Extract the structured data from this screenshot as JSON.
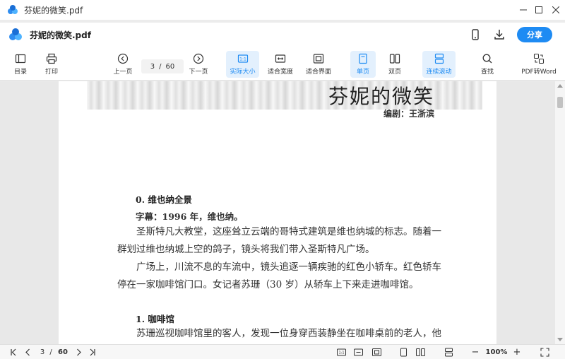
{
  "window": {
    "title": "芬妮的微笑.pdf",
    "controls": [
      "minimize-icon",
      "maximize-icon",
      "close-icon"
    ]
  },
  "header": {
    "doc_title": "芬妮的微笑.pdf",
    "share_label": "分享",
    "icons": [
      "mobile-icon",
      "download-icon"
    ]
  },
  "toolbar": {
    "toc": "目录",
    "print": "打印",
    "prev": "上一页",
    "current_page": "3",
    "separator": "/",
    "total_pages": "60",
    "next": "下一页",
    "actual_size": "实际大小",
    "fit_width": "适合宽度",
    "fit_page": "适合界面",
    "single_page": "单页",
    "double_page": "双页",
    "continuous": "连续滚动",
    "search": "查找",
    "pdf_to_word": "PDF转Word"
  },
  "document": {
    "title": "芬妮的微笑",
    "editor": "编剧：王浙滨",
    "sections": [
      {
        "heading": "0.  维也纳全景",
        "caption": "字幕：1996 年，维也纳。",
        "paragraphs": [
          "圣斯特凡大教堂，这座耸立云端的哥特式建筑是维也纳城的标志。随着一",
          "群划过维也纳城上空的鸽子，镜头将我们带入圣斯特凡广场。",
          "广场上，川流不息的车流中，镜头追逐一辆疾驰的红色小轿车。红色轿车",
          "停在一家咖啡馆门口。女记者苏珊（30 岁）从轿车上下来走进咖啡馆。"
        ]
      },
      {
        "heading": "1.  咖啡馆",
        "paragraphs": [
          "苏珊巡视咖啡馆里的客人，发现一位身穿西装静坐在咖啡桌前的老人，他"
        ]
      }
    ]
  },
  "statusbar": {
    "current_page": "3",
    "separator": "/",
    "total_pages": "60",
    "zoom": "100%",
    "minus": "−",
    "plus": "+"
  },
  "colors": {
    "accent": "#1e8bf3",
    "active_bg": "#e3f0fd",
    "background": "#e8e8e8"
  }
}
